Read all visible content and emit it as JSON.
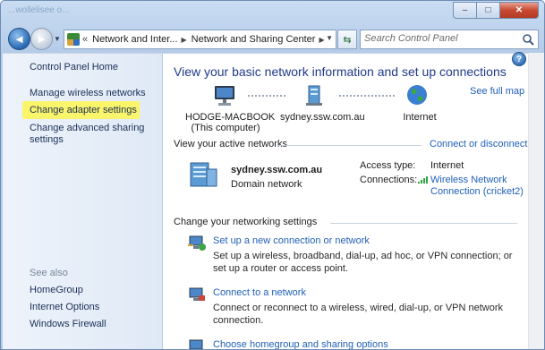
{
  "window": {
    "faded_title": "...wollelisee o...",
    "caption_min": "‒",
    "caption_max": "□",
    "caption_close": "✕"
  },
  "address_bar": {
    "segments": [
      "Network and Inter...",
      "Network and Sharing Center"
    ]
  },
  "search": {
    "placeholder": "Search Control Panel"
  },
  "sidebar": {
    "home": "Control Panel Home",
    "items": [
      {
        "label": "Manage wireless networks"
      },
      {
        "label": "Change adapter settings",
        "highlighted": true
      },
      {
        "label": "Change advanced sharing settings"
      }
    ],
    "see_also_heading": "See also",
    "see_also": [
      {
        "label": "HomeGroup"
      },
      {
        "label": "Internet Options"
      },
      {
        "label": "Windows Firewall"
      }
    ]
  },
  "main": {
    "title": "View your basic network information and set up connections",
    "see_full_map": "See full map",
    "map_nodes": [
      {
        "name": "HODGE-MACBOOK",
        "sub": "(This computer)",
        "icon": "computer-icon"
      },
      {
        "name": "sydney.ssw.com.au",
        "icon": "network-icon"
      },
      {
        "name": "Internet",
        "icon": "globe-icon"
      }
    ],
    "active_networks": {
      "heading": "View your active networks",
      "connect_disconnect": "Connect or disconnect",
      "network_name": "sydney.ssw.com.au",
      "network_type": "Domain network",
      "access_type_label": "Access type:",
      "access_type_value": "Internet",
      "connections_label": "Connections:",
      "connection_line1": "Wireless Network",
      "connection_line2": "Connection (cricket2)"
    },
    "settings": {
      "heading": "Change your networking settings",
      "tasks": [
        {
          "title": "Set up a new connection or network",
          "desc": "Set up a wireless, broadband, dial-up, ad hoc, or VPN connection; or set up a router or access point."
        },
        {
          "title": "Connect to a network",
          "desc": "Connect or reconnect to a wireless, wired, dial-up, or VPN network connection."
        },
        {
          "title": "Choose homegroup and sharing options"
        }
      ]
    }
  },
  "colors": {
    "link": "#2060b8",
    "title": "#1e3b8a",
    "highlight": "#fbf56b",
    "signal_green": "#2fa640"
  }
}
